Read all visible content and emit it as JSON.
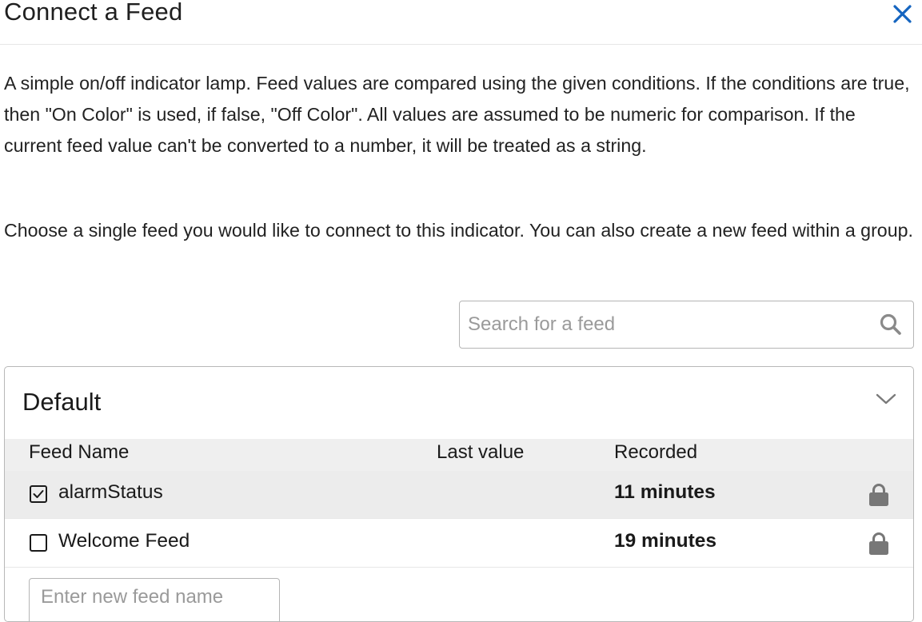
{
  "dialog": {
    "title": "Connect a Feed",
    "close_icon": "close-icon"
  },
  "description": {
    "paragraph1": "A simple on/off indicator lamp. Feed values are compared using the given conditions. If the conditions are true, then \"On Color\" is used, if false, \"Off Color\". All values are assumed to be numeric for comparison. If the current feed value can't be converted to a number, it will be treated as a string.",
    "paragraph2": "Choose a single feed you would like to connect to this indicator. You can also create a new feed within a group."
  },
  "search": {
    "placeholder": "Search for a feed",
    "value": "",
    "icon": "search-icon"
  },
  "group": {
    "title": "Default",
    "expanded": true,
    "columns": {
      "feed_name": "Feed Name",
      "last_value": "Last value",
      "recorded": "Recorded"
    },
    "feeds": [
      {
        "name": "alarmStatus",
        "last_value": "",
        "recorded": "11 minutes",
        "checked": true,
        "locked": true
      },
      {
        "name": "Welcome Feed",
        "last_value": "",
        "recorded": "19 minutes",
        "checked": false,
        "locked": true
      }
    ],
    "new_feed": {
      "placeholder": "Enter new feed name",
      "value": ""
    }
  },
  "colors": {
    "accent": "#1565c0",
    "selected_row": "#ececec",
    "header_row": "#efefef",
    "lock_icon": "#777777"
  }
}
